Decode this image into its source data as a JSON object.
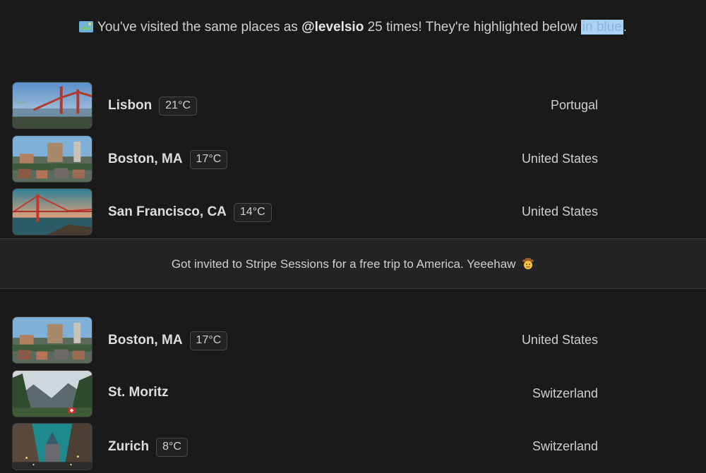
{
  "banner": {
    "icon": "map-icon",
    "prefix": "You've visited the same places as",
    "username": "@levelsio",
    "middle": "25 times! They're highlighted below",
    "highlight": "in blue",
    "suffix": "."
  },
  "places_before": [
    {
      "city": "Lisbon",
      "temp": "21°C",
      "country": "Portugal",
      "image": "lisbon-bridge-photo"
    },
    {
      "city": "Boston, MA",
      "temp": "17°C",
      "country": "United States",
      "image": "boston-city-photo"
    },
    {
      "city": "San Francisco, CA",
      "temp": "14°C",
      "country": "United States",
      "image": "golden-gate-photo"
    }
  ],
  "note": {
    "text": "Got invited to Stripe Sessions for a free trip to America. Yeeehaw",
    "emoji": "cowboy-face-emoji"
  },
  "places_after": [
    {
      "city": "Boston, MA",
      "temp": "17°C",
      "country": "United States",
      "image": "boston-city-photo"
    },
    {
      "city": "St. Moritz",
      "temp": "",
      "country": "Switzerland",
      "image": "mountain-valley-photo"
    },
    {
      "city": "Zurich",
      "temp": "8°C",
      "country": "Switzerland",
      "image": "zurich-street-photo"
    }
  ],
  "colors": {
    "background": "#1a1a1a",
    "note_background": "#242424",
    "highlight": "#a9d2f5"
  }
}
